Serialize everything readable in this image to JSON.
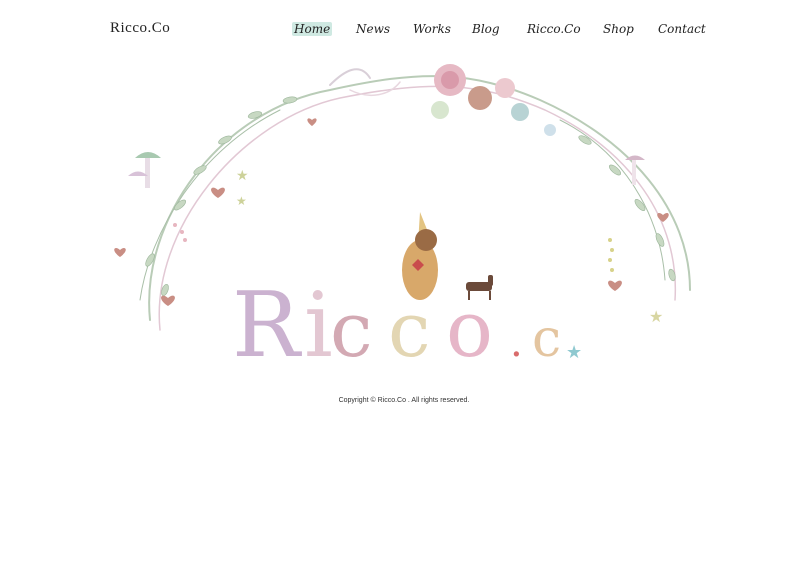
{
  "site": {
    "brand": "Ricco.Co",
    "accent": "#cfe9e2",
    "nav": [
      {
        "label": "Home",
        "active": true
      },
      {
        "label": "News",
        "active": false
      },
      {
        "label": "Works",
        "active": false
      },
      {
        "label": "Blog",
        "active": false
      },
      {
        "label": "Ricco.Co",
        "active": false
      },
      {
        "label": "Shop",
        "active": false
      },
      {
        "label": "Contact",
        "active": false
      }
    ]
  },
  "hero": {
    "illustration": "floral-wreath-arch",
    "letters": [
      "R",
      "i",
      "c",
      "c",
      "o",
      ".",
      "c"
    ]
  },
  "footer": {
    "copyright": "Copyright © Ricco.Co . All rights reserved."
  }
}
